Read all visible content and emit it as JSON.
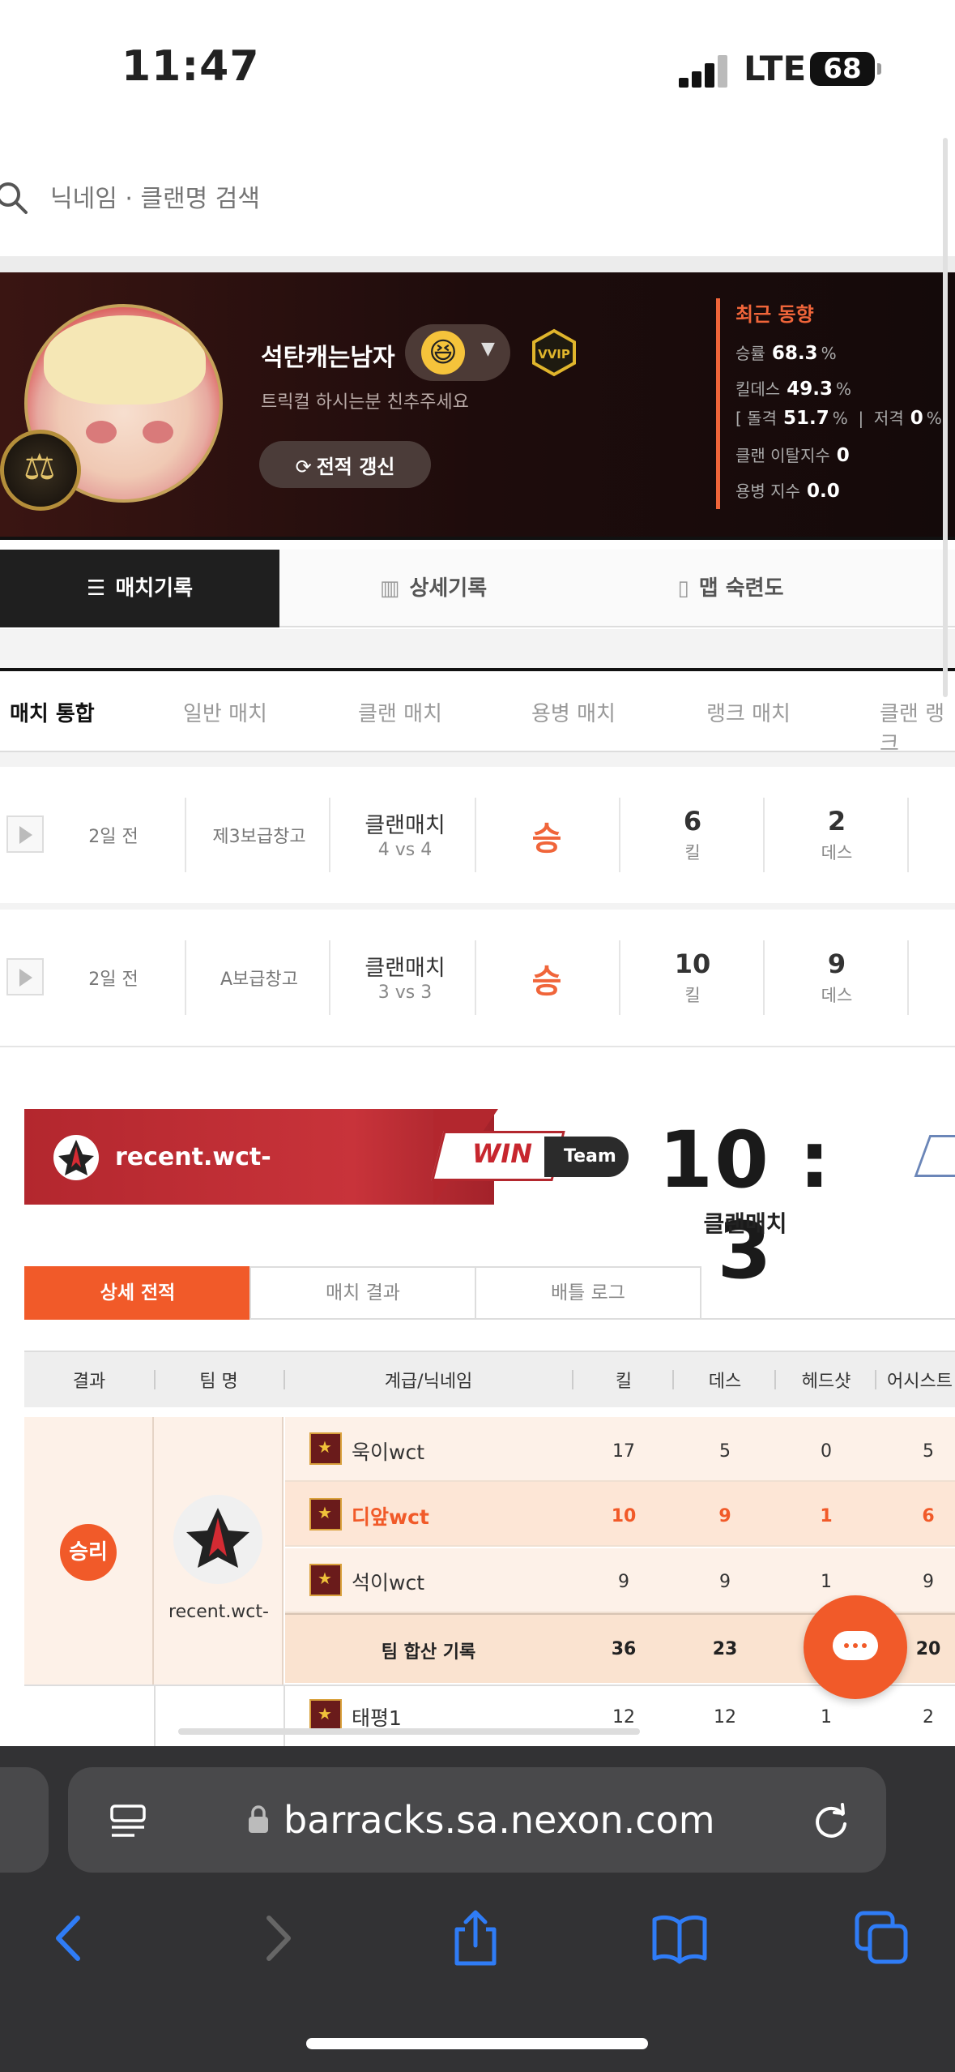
{
  "status_bar": {
    "time": "11:47",
    "network": "LTE",
    "battery": "68"
  },
  "search": {
    "placeholder": "닉네임 · 클랜명 검색"
  },
  "profile": {
    "nickname": "석탄캐는남자",
    "status_message": "트릭컬 하시는분 친추주세요",
    "refresh_label": "전적 갱신",
    "stats_title": "최근 동향",
    "stats": {
      "win_rate_label": "승률",
      "win_rate": "68.3",
      "pct": "%",
      "kd_label": "킬데스",
      "kd": "49.3",
      "assault_label": "돌격",
      "assault": "51.7",
      "sniper_label": "저격",
      "sniper": "0",
      "clan_leave_label": "클랜 이탈지수",
      "clan_leave": "0",
      "merc_label": "용병 지수",
      "merc": "0.0"
    }
  },
  "main_tabs": [
    {
      "label": "매치기록",
      "icon": "list-icon"
    },
    {
      "label": "상세기록",
      "icon": "chart-icon"
    },
    {
      "label": "맵 숙련도",
      "icon": "map-icon"
    }
  ],
  "sub_tabs": [
    "매치 통합",
    "일반 매치",
    "클랜 매치",
    "용병 매치",
    "랭크 매치",
    "클랜 랭크"
  ],
  "matches": [
    {
      "time": "2일 전",
      "map": "제3보급창고",
      "mode": "클랜매치",
      "vs": "4 vs 4",
      "result": "승",
      "kills": "6",
      "kill_label": "킬",
      "deaths": "2",
      "death_label": "데스"
    },
    {
      "time": "2일 전",
      "map": "A보급창고",
      "mode": "클랜매치",
      "vs": "3 vs 3",
      "result": "승",
      "kills": "10",
      "kill_label": "킬",
      "deaths": "9",
      "death_label": "데스"
    }
  ],
  "match_detail": {
    "team_name": "recent.wct-",
    "win_label": "WIN",
    "team_tag": "Team",
    "score": "10 : 3",
    "mode": "클랜매치",
    "tabs": [
      "상세 전적",
      "매치 결과",
      "배틀 로그"
    ],
    "table": {
      "headers": [
        "결과",
        "팀 명",
        "계급/닉네임",
        "킬",
        "데스",
        "헤드샷",
        "어시스트"
      ],
      "result": "승리",
      "team": "recent.wct-",
      "players": [
        {
          "name": "욱이wct",
          "kills": "17",
          "deaths": "5",
          "headshots": "0",
          "assists": "5"
        },
        {
          "name": "디앞wct",
          "kills": "10",
          "deaths": "9",
          "headshots": "1",
          "assists": "6"
        },
        {
          "name": "석이wct",
          "kills": "9",
          "deaths": "9",
          "headshots": "1",
          "assists": "9"
        }
      ],
      "total_label": "팀 합산 기록",
      "totals": {
        "kills": "36",
        "deaths": "23",
        "assists": "20"
      },
      "next_player": {
        "name": "태평1",
        "kills": "12",
        "deaths": "12",
        "headshots": "1",
        "assists": "2"
      }
    }
  },
  "browser": {
    "url": "barracks.sa.nexon.com"
  },
  "colors": {
    "accent": "#f15a29",
    "banner": "#2a100e",
    "team_red": "#b3272e"
  }
}
